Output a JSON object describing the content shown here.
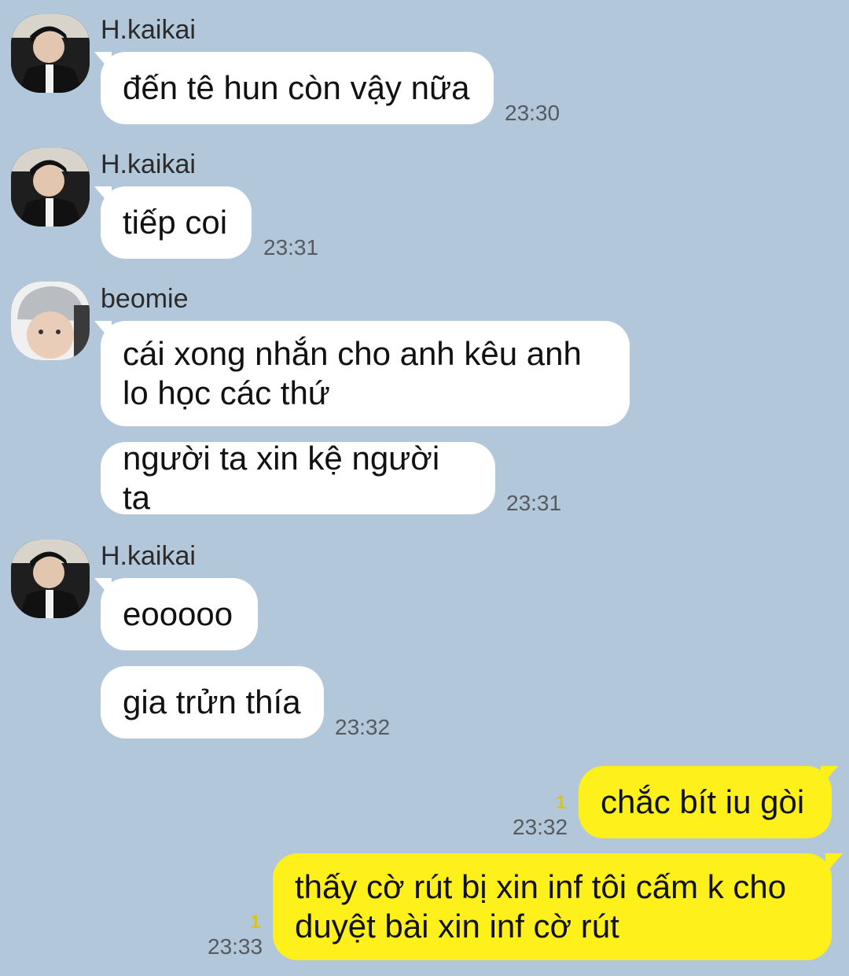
{
  "messages": [
    {
      "sender": "H.kaikai",
      "text": "đến tê hun còn vậy nữa",
      "time": "23:30"
    },
    {
      "sender": "H.kaikai",
      "text": "tiếp coi",
      "time": "23:31"
    },
    {
      "sender": "beomie",
      "line1": "cái xong nhắn cho anh kêu anh",
      "line2": "lo học các thứ"
    },
    {
      "text": "người ta xin kệ người ta",
      "time": "23:31"
    },
    {
      "sender": "H.kaikai",
      "text": "eooooo"
    },
    {
      "text": "gia trửn thía",
      "time": "23:32"
    },
    {
      "mine": true,
      "text": "chắc bít iu gòi",
      "time": "23:32",
      "unread": "1"
    },
    {
      "mine": true,
      "line1": "thấy cờ rút bị xin inf tôi cấm k cho",
      "line2": "duyệt bài xin inf cờ rút",
      "time": "23:33",
      "unread": "1"
    }
  ],
  "colors": {
    "background": "#b2c7da",
    "incoming_bubble": "#ffffff",
    "outgoing_bubble": "#fef01b",
    "unread_count": "#d6c51c"
  }
}
